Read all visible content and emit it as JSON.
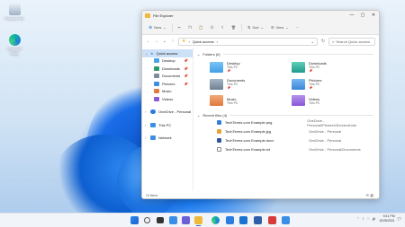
{
  "desktop": {
    "icons": [
      {
        "label": "Recycle Bin"
      },
      {
        "label": "Microsoft Edge"
      }
    ]
  },
  "window": {
    "title": "File Explorer",
    "controls": [
      "—",
      "▢",
      "✕"
    ]
  },
  "ribbon": {
    "new_label": "New",
    "sort_label": "Sort",
    "view_label": "View",
    "more_label": "···"
  },
  "address": {
    "path_root": "Quick access",
    "search_placeholder": "Search Quick access"
  },
  "nav_pane": {
    "items": [
      {
        "label": "Quick access",
        "pinned": false,
        "color": "#3b8fe3"
      },
      {
        "label": "Desktop",
        "pinned": true,
        "color": "#46a3e8"
      },
      {
        "label": "Downloads",
        "pinned": true,
        "color": "#2d9a6e"
      },
      {
        "label": "Documents",
        "pinned": true,
        "color": "#7f8c99"
      },
      {
        "label": "Pictures",
        "pinned": true,
        "color": "#3f8ee0"
      },
      {
        "label": "Music",
        "pinned": false,
        "color": "#e07a3f"
      },
      {
        "label": "Videos",
        "pinned": false,
        "color": "#8b5ad6"
      },
      {
        "label": "OneDrive - Personal",
        "pinned": false,
        "color": "#2c7be5"
      },
      {
        "label": "This PC",
        "pinned": false,
        "color": "#3b8fe3"
      },
      {
        "label": "Network",
        "pinned": false,
        "color": "#3b8fe3"
      }
    ]
  },
  "content": {
    "folders_header": "Folders (6)",
    "folders": [
      {
        "name": "Desktop",
        "sub": "This PC",
        "color": "#3f9fe6"
      },
      {
        "name": "Downloads",
        "sub": "This PC",
        "color": "#1f9a8a"
      },
      {
        "name": "Documents",
        "sub": "This PC",
        "color": "#6d7f92"
      },
      {
        "name": "Pictures",
        "sub": "This PC",
        "color": "#3a86d8"
      },
      {
        "name": "Music",
        "sub": "This PC",
        "color": "#e0793f"
      },
      {
        "name": "Videos",
        "sub": "This PC",
        "color": "#8a56d9"
      }
    ],
    "recent_header": "Recent files (4)",
    "recent": [
      {
        "name": "TechTerms.com Example.png",
        "location": "OneDrive - Personal\\Pictures\\Screenshots",
        "color": "#2f7fd6"
      },
      {
        "name": "TechTerms.com Example.jpg",
        "location": "OneDrive - Personal",
        "color": "#e6a13b"
      },
      {
        "name": "TechTerms.com Example.docx",
        "location": "OneDrive - Personal",
        "color": "#2b579a"
      },
      {
        "name": "TechTerms.com Example.txt",
        "location": "OneDrive - Personal\\Documents",
        "color": "#888888"
      }
    ]
  },
  "status": {
    "items_text": "10 items"
  },
  "taskbar": {
    "icons": [
      {
        "name": "start",
        "color": "#1f6fd6"
      },
      {
        "name": "search",
        "color": "#555555"
      },
      {
        "name": "task-view",
        "color": "#333333"
      },
      {
        "name": "widgets",
        "color": "#3a8ee6"
      },
      {
        "name": "chat",
        "color": "#6b5fd6"
      },
      {
        "name": "file-explorer",
        "color": "#f0b93a"
      },
      {
        "name": "edge",
        "color": "#1c9ad6"
      },
      {
        "name": "store",
        "color": "#2a7de1"
      },
      {
        "name": "mail",
        "color": "#1a73d1"
      },
      {
        "name": "lens",
        "color": "#2e5fa8"
      },
      {
        "name": "acrobat",
        "color": "#d63a3a"
      },
      {
        "name": "photo",
        "color": "#3a8ee6"
      }
    ],
    "time": "9:41 PM",
    "date": "10/28/2021"
  }
}
